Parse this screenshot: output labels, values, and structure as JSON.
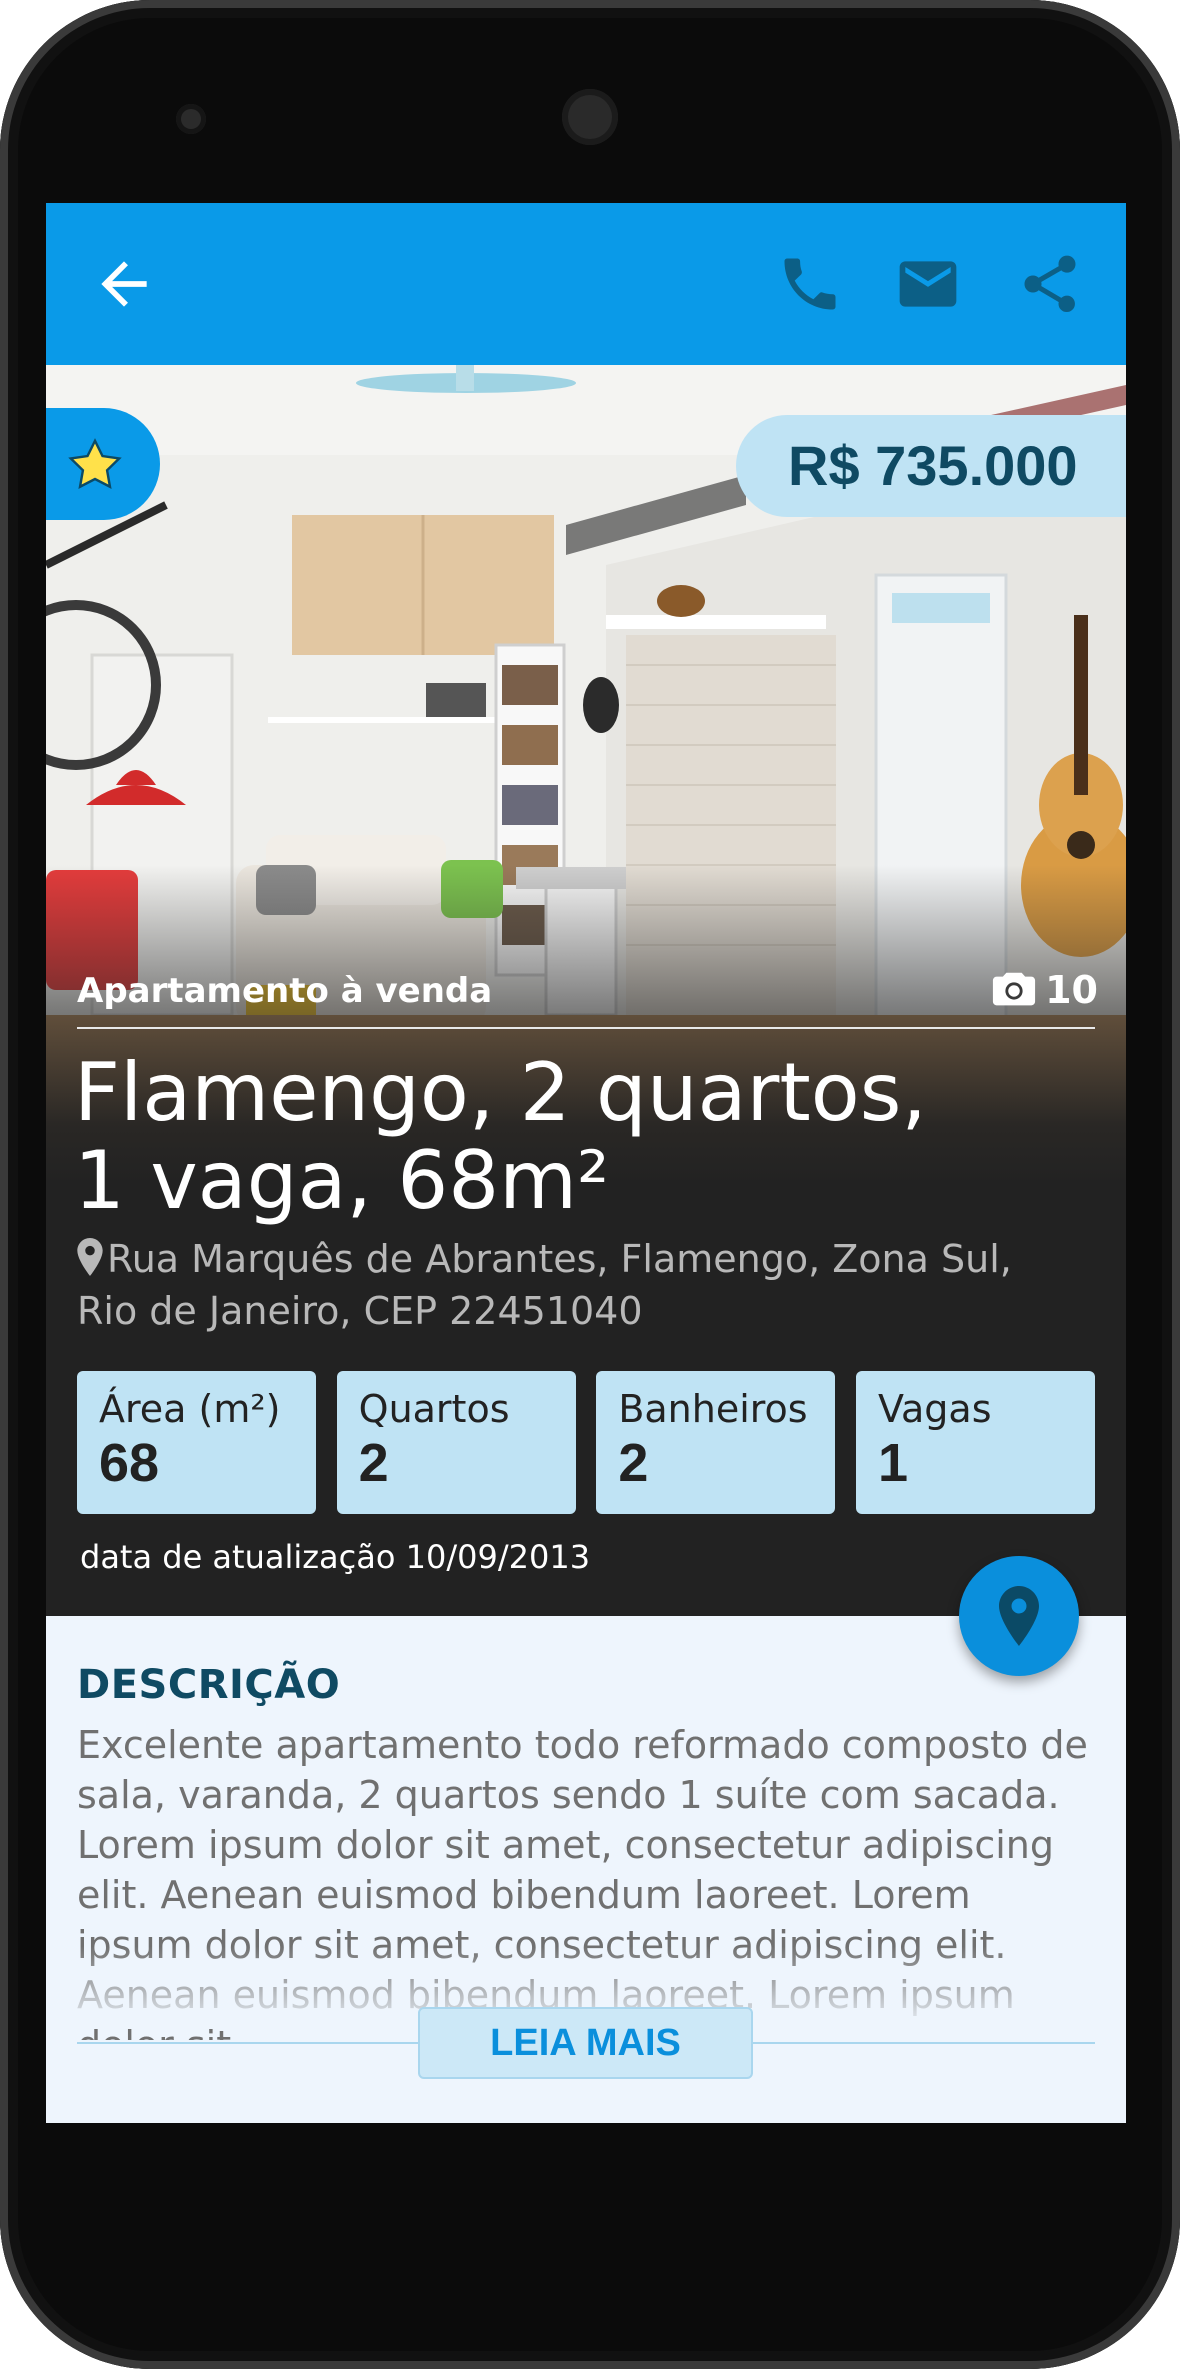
{
  "colors": {
    "accent": "#0a9ae8",
    "badge_bg": "#bfe3f4",
    "badge_text": "#0f4a63",
    "dark_bg": "#222222",
    "description_bg": "#eef5fd",
    "star": "#ffe14a"
  },
  "appbar": {
    "icons": [
      "arrow-back-icon",
      "phone-icon",
      "mail-icon",
      "share-icon"
    ]
  },
  "listing": {
    "price": "R$ 735.000",
    "type": "Apartamento à venda",
    "photo_count": "10",
    "title_line1": "Flamengo, 2 quartos,",
    "title_line2": "1 vaga, 68m²",
    "address_line1": "Rua Marquês de Abrantes, Flamengo, Zona Sul,",
    "address_line2": "Rio de Janeiro, CEP 22451040",
    "updated": "data de atualização 10/09/2013"
  },
  "stats": [
    {
      "label": "Área (m²)",
      "value": "68"
    },
    {
      "label": "Quartos",
      "value": "2"
    },
    {
      "label": "Banheiros",
      "value": "2"
    },
    {
      "label": "Vagas",
      "value": "1"
    }
  ],
  "description": {
    "heading": "DESCRIÇÃO",
    "text": "Excelente apartamento todo reformado composto de sala, varanda, 2 quartos sendo 1 suíte com sacada. Lorem ipsum dolor sit amet, consectetur adipiscing elit. Aenean euismod bibendum laoreet. Lorem ipsum dolor sit amet, consectetur adipiscing elit. Aenean euismod bibendum laoreet. Lorem ipsum dolor sit",
    "read_more": "LEIA MAIS"
  }
}
